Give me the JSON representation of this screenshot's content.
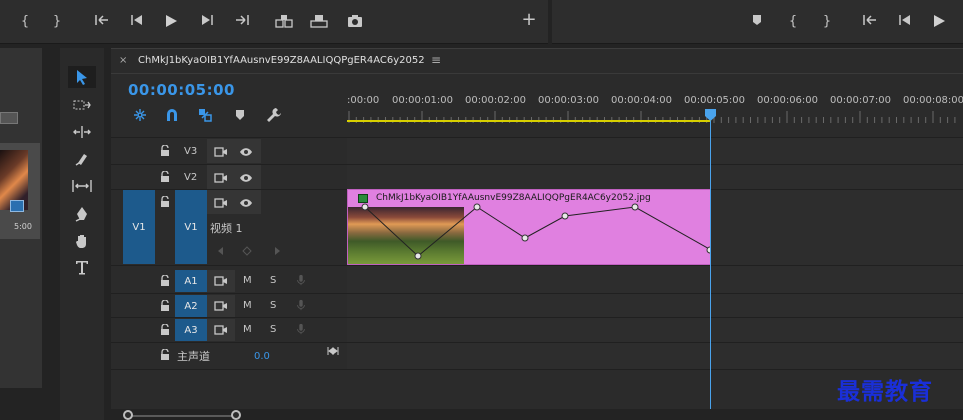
{
  "timeline": {
    "tab_close": "×",
    "sequence_name": "ChMkJ1bKyaOIB1YfAAusnvE99Z8AALIQQPgER4AC6y2052",
    "timecode": "00:00:05:00",
    "ruler_labels": [
      ":00:00",
      "00:00:01:00",
      "00:00:02:00",
      "00:00:03:00",
      "00:00:04:00",
      "00:00:05:00",
      "00:00:06:00",
      "00:00:07:00",
      "00:00:08:00"
    ],
    "playhead_time": "00:00:05:00"
  },
  "tracks": {
    "video": [
      {
        "name": "V3"
      },
      {
        "name": "V2"
      },
      {
        "name": "V1",
        "source_target": "V1",
        "label": "视频 1"
      }
    ],
    "audio": [
      {
        "name": "A1",
        "mute": "M",
        "solo": "S"
      },
      {
        "name": "A2",
        "mute": "M",
        "solo": "S"
      },
      {
        "name": "A3",
        "mute": "M",
        "solo": "S"
      }
    ],
    "master": {
      "label": "主声道",
      "value": "0.0"
    }
  },
  "clip": {
    "name": "ChMkJ1bKyaOIB1YfAAusnvE99Z8AALIQQPgER4AC6y2052.jpg",
    "color": "#e080e0"
  },
  "project_panel": {
    "duration": "5:00"
  },
  "accent_color": "#3a96e8",
  "watermark": "最需教育"
}
